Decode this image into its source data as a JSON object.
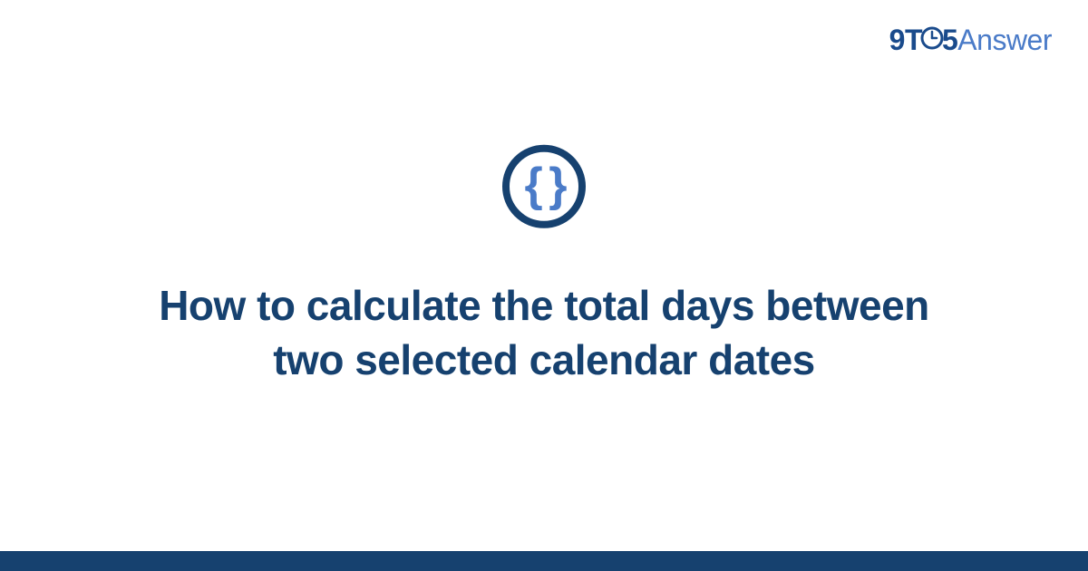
{
  "logo": {
    "nine": "9",
    "t": "T",
    "five": "5",
    "answer": "Answer"
  },
  "icon": {
    "braces": "{ }"
  },
  "title": "How to calculate the total days between two selected calendar dates"
}
